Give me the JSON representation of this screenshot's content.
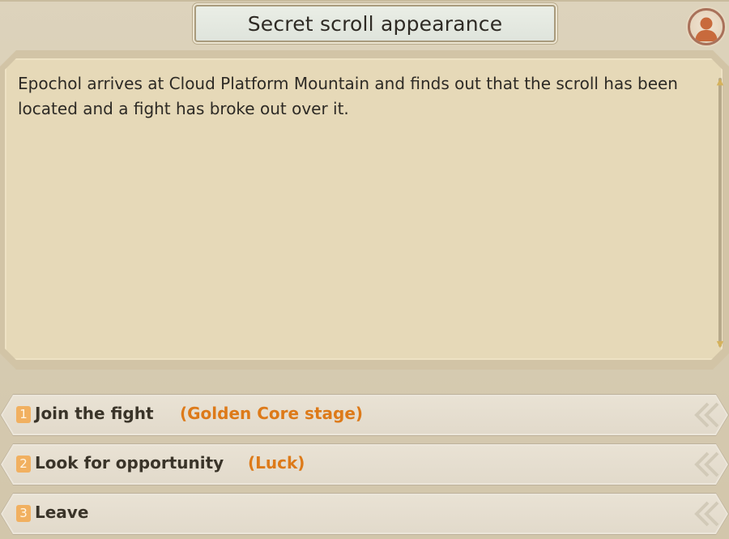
{
  "dialog": {
    "title": "Secret scroll appearance",
    "body": "Epochol arrives at Cloud Platform Mountain and finds out that the scroll has been located and a fight has broke out over it."
  },
  "options": [
    {
      "number": "1",
      "label": "Join the fight",
      "requirement": "(Golden Core stage)"
    },
    {
      "number": "2",
      "label": "Look for opportunity",
      "requirement": "(Luck)"
    },
    {
      "number": "3",
      "label": "Leave",
      "requirement": ""
    }
  ],
  "icons": {
    "avatar": "character-portrait-icon",
    "scroll_up": "scroll-up-arrow-icon",
    "scroll_down": "scroll-down-arrow-icon",
    "option_decoration": "chevron-ornament-icon"
  },
  "colors": {
    "requirement_text": "#dd7a19",
    "number_badge": "#f1b060",
    "panel_fill": "#e6d9b8"
  }
}
